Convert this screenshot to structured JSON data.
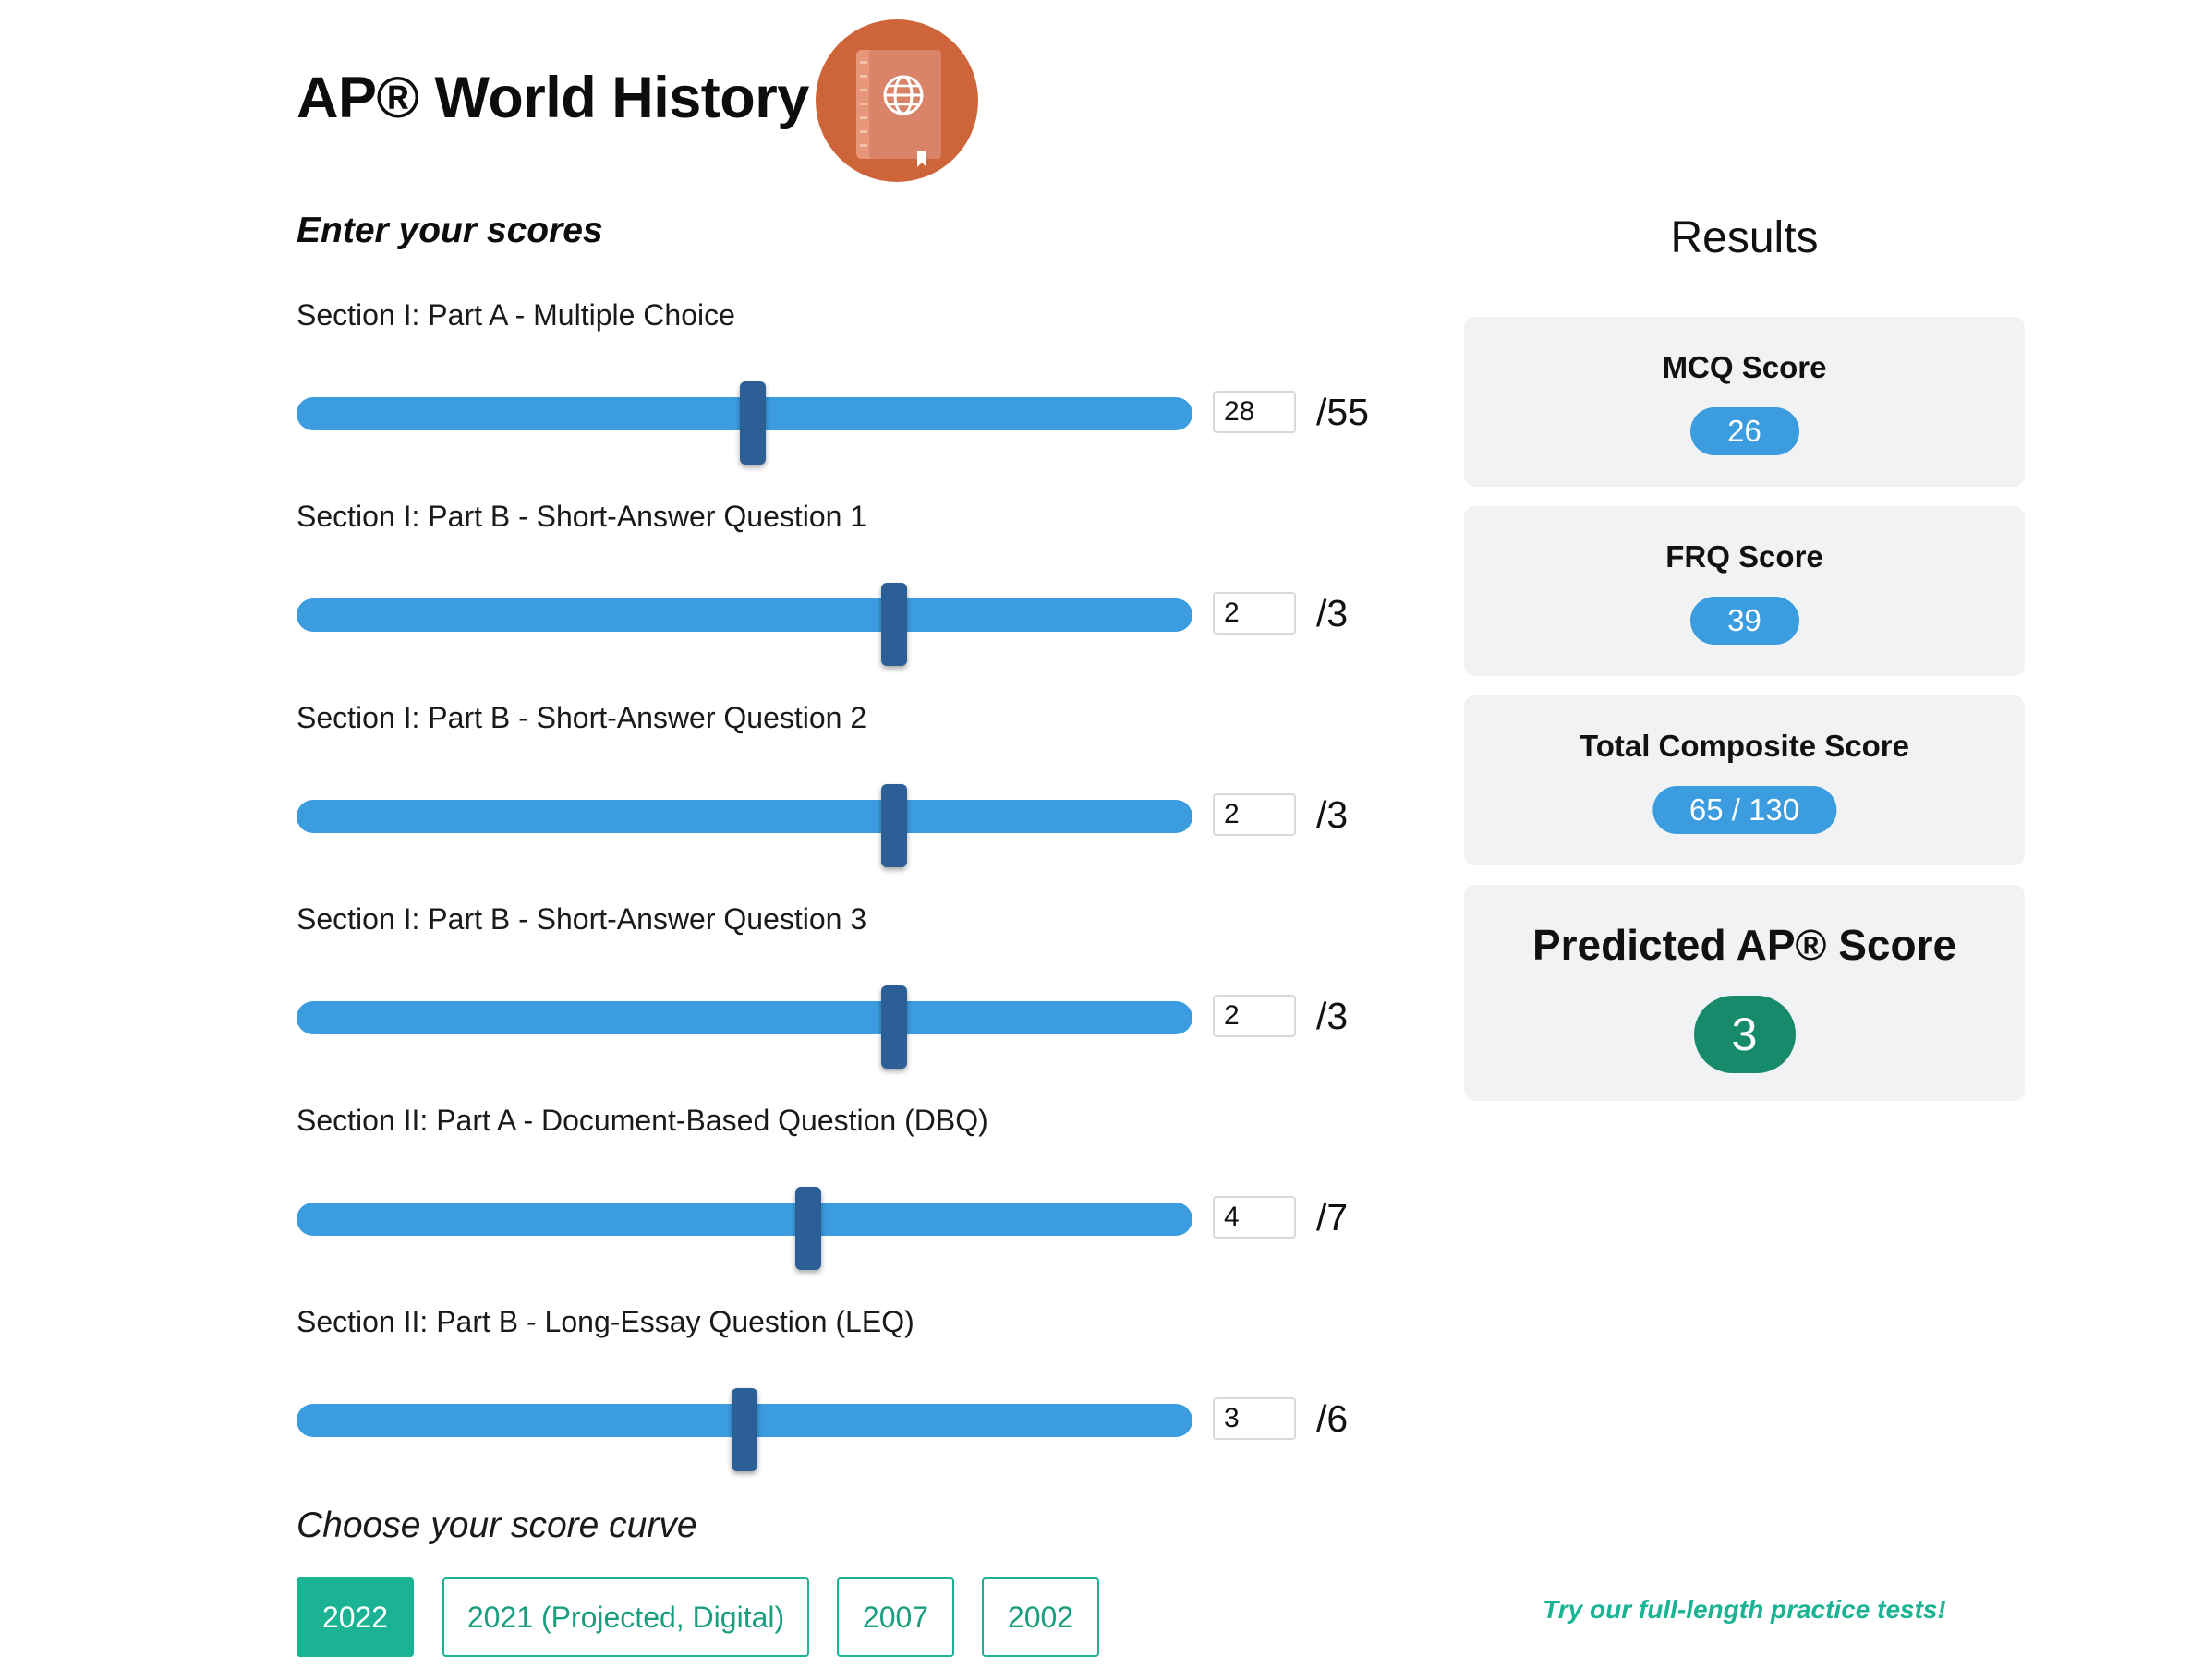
{
  "header": {
    "title": "AP® World History",
    "logo_icon": "book-globe-icon",
    "logo_color": "#ce643a"
  },
  "inputs_section": {
    "title": "Enter your scores",
    "sliders": [
      {
        "label": "Section I: Part A - Multiple Choice",
        "value": "28",
        "max_text": "/55",
        "value_num": 28,
        "max_num": 55
      },
      {
        "label": "Section I: Part B - Short-Answer Question 1",
        "value": "2",
        "max_text": "/3",
        "value_num": 2,
        "max_num": 3
      },
      {
        "label": "Section I: Part B - Short-Answer Question 2",
        "value": "2",
        "max_text": "/3",
        "value_num": 2,
        "max_num": 3
      },
      {
        "label": "Section I: Part B - Short-Answer Question 3",
        "value": "2",
        "max_text": "/3",
        "value_num": 2,
        "max_num": 3
      },
      {
        "label": "Section II: Part A - Document-Based Question (DBQ)",
        "value": "4",
        "max_text": "/7",
        "value_num": 4,
        "max_num": 7
      },
      {
        "label": "Section II: Part B - Long-Essay Question (LEQ)",
        "value": "3",
        "max_text": "/6",
        "value_num": 3,
        "max_num": 6
      }
    ]
  },
  "curve": {
    "title": "Choose your score curve",
    "options": [
      "2022",
      "2021 (Projected, Digital)",
      "2007",
      "2002"
    ],
    "selected": "2022"
  },
  "results": {
    "title": "Results",
    "mcq": {
      "label": "MCQ Score",
      "value": "26"
    },
    "frq": {
      "label": "FRQ Score",
      "value": "39"
    },
    "composite": {
      "label": "Total Composite Score",
      "value": "65 / 130"
    },
    "predicted": {
      "label": "Predicted AP® Score",
      "value": "3"
    }
  },
  "promo": {
    "text": "Try our full-length practice tests!"
  },
  "colors": {
    "slider_track": "#3b9ddf",
    "slider_thumb": "#2c5f95",
    "accent_teal": "#1ab394",
    "score_badge": "#168a6a",
    "card_bg": "#f1f2f3"
  }
}
